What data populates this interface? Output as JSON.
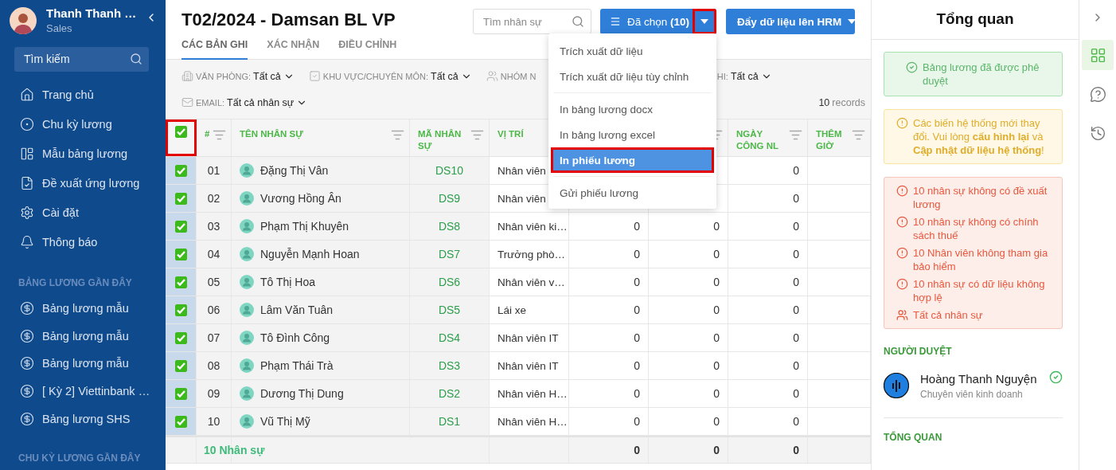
{
  "sidebar": {
    "user": {
      "name": "Thanh Thanh …",
      "role": "Sales"
    },
    "search": {
      "placeholder": "Tìm kiếm"
    },
    "nav": [
      {
        "label": "Trang chủ"
      },
      {
        "label": "Chu kỳ lương"
      },
      {
        "label": "Mẫu bảng lương"
      },
      {
        "label": "Đề xuất ứng lương"
      },
      {
        "label": "Cài đặt"
      },
      {
        "label": "Thông báo"
      }
    ],
    "sections": [
      {
        "heading": "BẢNG LƯƠNG GẦN ĐÂY",
        "items": [
          {
            "label": "Bảng lương mẫu"
          },
          {
            "label": "Bảng lương mẫu"
          },
          {
            "label": "Bảng lương mẫu"
          },
          {
            "label": "[ Kỳ 2] Viettinbank …"
          },
          {
            "label": "Bảng lương SHS"
          }
        ]
      },
      {
        "heading": "CHU KỲ LƯƠNG GẦN ĐÂY"
      }
    ]
  },
  "page": {
    "title": "T02/2024 - Damsan BL VP",
    "search": {
      "placeholder": "Tìm nhân sự"
    },
    "selected_button": {
      "label": "Đã chọn **(10)**"
    },
    "caret_button": {
      "highlighted": true
    },
    "push_button": {
      "label": "Đẩy dữ liệu lên HRM"
    },
    "tabs": [
      {
        "label": "CÁC BẢN GHI",
        "selected": true
      },
      {
        "label": "XÁC NHẬN",
        "selected": false
      },
      {
        "label": "ĐIỀU CHỈNH",
        "selected": false
      }
    ],
    "filters": [
      {
        "label": "VĂN PHÒNG:",
        "value": "Tất cả"
      },
      {
        "label": "KHU VỰC/CHUYÊN MÔN:",
        "value": "Tất cả"
      },
      {
        "label": "NHÓM N"
      },
      {
        "label": "HI:",
        "value": "Tất cả"
      },
      {
        "label": "EMAIL:",
        "value": "Tất cả nhân sự"
      }
    ],
    "records": {
      "count": "10",
      "unit": "records"
    },
    "menu": {
      "groups": [
        {
          "items": [
            {
              "label": "Trích xuất dữ liệu",
              "selected": false,
              "highlighted": false
            },
            {
              "label": "Trích xuất dữ liệu tùy chỉnh",
              "selected": false,
              "highlighted": false
            }
          ]
        },
        {
          "items": [
            {
              "label": "In bảng lương docx",
              "selected": false,
              "highlighted": false
            },
            {
              "label": "In bảng lương excel",
              "selected": false,
              "highlighted": false
            },
            {
              "label": "In phiếu lương",
              "selected": true,
              "highlighted": true
            }
          ]
        },
        {
          "items": [
            {
              "label": "Gửi phiếu lương",
              "selected": false,
              "highlighted": false
            }
          ]
        }
      ]
    },
    "table": {
      "select_all": {
        "checked": true,
        "highlighted": true
      },
      "columns": [
        {
          "label": "#",
          "filter": true
        },
        {
          "label": "TÊN NHÂN SỰ",
          "filter": true
        },
        {
          "label": "MÃ NHÂN SỰ",
          "filter": true
        },
        {
          "label": "VỊ TRÍ"
        },
        {},
        {
          "filter": true
        },
        {
          "label": "NGÀY CÔNG NL",
          "filter": true
        },
        {
          "label": "THÊM GIỜ",
          "filter": true
        }
      ],
      "rows": [
        {
          "checked": true,
          "no": "01",
          "name": "Đặng Thị Vân",
          "code": "DS10",
          "position": "Nhân viên",
          "ngay_cong_nl": "0"
        },
        {
          "checked": true,
          "no": "02",
          "name": "Vương Hồng Ân",
          "code": "DS9",
          "position": "Nhân viên",
          "ngay_cong_nl": "0"
        },
        {
          "checked": true,
          "no": "03",
          "name": "Phạm Thị Khuyên",
          "code": "DS8",
          "position": "Nhân viên ki…",
          "column_5": "0",
          "column_6": "0",
          "ngay_cong_nl": "0"
        },
        {
          "checked": true,
          "no": "04",
          "name": "Nguyễn Mạnh Hoan",
          "code": "DS7",
          "position": "Trưởng phò…",
          "column_5": "0",
          "column_6": "0",
          "ngay_cong_nl": "0"
        },
        {
          "checked": true,
          "no": "05",
          "name": "Tô Thị Hoa",
          "code": "DS6",
          "position": "Nhân viên v…",
          "column_5": "0",
          "column_6": "0",
          "ngay_cong_nl": "0"
        },
        {
          "checked": true,
          "no": "06",
          "name": "Lâm Văn Tuân",
          "code": "DS5",
          "position": "Lái xe",
          "column_5": "0",
          "column_6": "0",
          "ngay_cong_nl": "0"
        },
        {
          "checked": true,
          "no": "07",
          "name": "Tô Đình Công",
          "code": "DS4",
          "position": "Nhân viên IT",
          "column_5": "0",
          "column_6": "0",
          "ngay_cong_nl": "0"
        },
        {
          "checked": true,
          "no": "08",
          "name": "Phạm Thái Trà",
          "code": "DS3",
          "position": "Nhân viên IT",
          "column_5": "0",
          "column_6": "0",
          "ngay_cong_nl": "0"
        },
        {
          "checked": true,
          "no": "09",
          "name": "Dương Thị Dung",
          "code": "DS2",
          "position": "Nhân viên H…",
          "column_5": "0",
          "column_6": "0",
          "ngay_cong_nl": "0"
        },
        {
          "checked": true,
          "no": "10",
          "name": "Vũ Thị Mỹ",
          "code": "DS1",
          "position": "Nhân viên H…",
          "column_5": "0",
          "column_6": "0",
          "ngay_cong_nl": "0"
        }
      ],
      "footer": {
        "label": "10 Nhân sự",
        "column_5": "0",
        "column_6": "0",
        "ngay_cong_nl": "0"
      }
    }
  },
  "overview": {
    "title": "Tổng quan",
    "notices": [
      {
        "kind": "success",
        "text": "Bảng lương đã được phê duyệt"
      },
      {
        "kind": "warning",
        "text": "Các biến hệ thống mới thay đổi. Vui lòng **cấu hình lại** và **Cập nhật dữ liệu hệ thống**!"
      },
      {
        "kind": "error",
        "items": [
          {
            "kind": "alert",
            "text": "10 nhân sự không có đề xuất lương"
          },
          {
            "kind": "alert",
            "text": "10 nhân sự không có chính sách thuế"
          },
          {
            "kind": "alert",
            "text": "10 Nhân viên không tham gia bảo hiểm"
          },
          {
            "kind": "alert",
            "text": "10 nhân sự có dữ liệu không hợp lệ"
          },
          {
            "kind": "people",
            "text": "Tất cả nhân sự"
          }
        ]
      }
    ],
    "approvers_heading": "NGƯỜI DUYỆT",
    "approver": {
      "name": "Hoàng Thanh Nguyện",
      "role": "Chuyên viên kinh doanh",
      "approved": true
    },
    "summary_heading": "TỔNG QUAN"
  },
  "rail": {
    "tabs": [
      {
        "selected": true
      },
      {
        "selected": false
      },
      {
        "selected": false
      }
    ]
  }
}
